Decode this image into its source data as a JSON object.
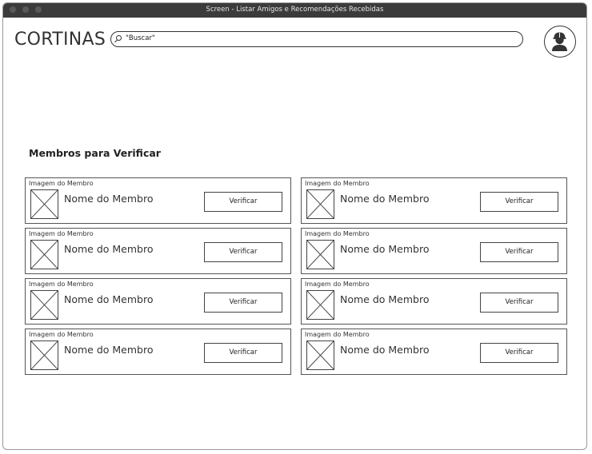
{
  "window": {
    "title": "Screen - Listar Amigos e Recomendações Recebidas"
  },
  "header": {
    "brand": "CORTINAS",
    "search": {
      "value": "\"Buscar\"",
      "icon": "search-icon"
    },
    "avatar": {
      "icon": "user-avatar-icon"
    }
  },
  "main": {
    "section_title": "Membros para Verificar",
    "members": [
      {
        "image_label": "Imagem do Membro",
        "name": "Nome do Membro",
        "button": "Verificar"
      },
      {
        "image_label": "Imagem do Membro",
        "name": "Nome do Membro",
        "button": "Verificar"
      },
      {
        "image_label": "Imagem do Membro",
        "name": "Nome do Membro",
        "button": "Verificar"
      },
      {
        "image_label": "Imagem do Membro",
        "name": "Nome do Membro",
        "button": "Verificar"
      },
      {
        "image_label": "Imagem do Membro",
        "name": "Nome do Membro",
        "button": "Verificar"
      },
      {
        "image_label": "Imagem do Membro",
        "name": "Nome do Membro",
        "button": "Verificar"
      },
      {
        "image_label": "Imagem do Membro",
        "name": "Nome do Membro",
        "button": "Verificar"
      },
      {
        "image_label": "Imagem do Membro",
        "name": "Nome do Membro",
        "button": "Verificar"
      }
    ]
  },
  "colors": {
    "titlebar_bg": "#3b3b3b",
    "border": "#555555",
    "text": "#222222"
  }
}
